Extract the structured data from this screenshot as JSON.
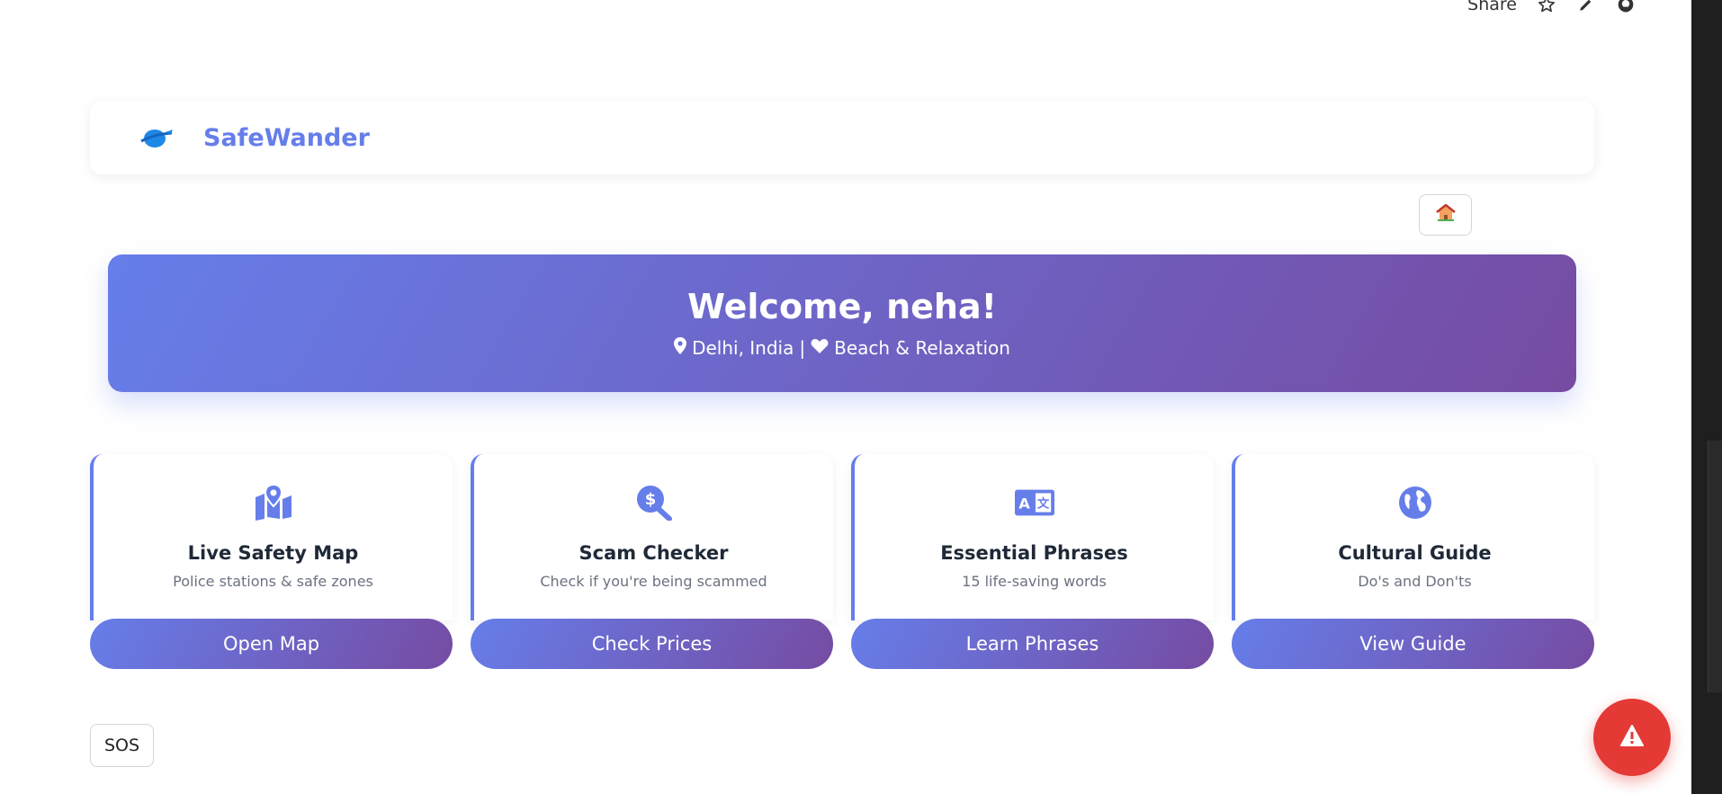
{
  "toolbar": {
    "share_label": "Share",
    "icons": [
      "star-icon",
      "pencil-icon",
      "github-icon"
    ]
  },
  "header": {
    "brand": "SafeWander",
    "logo_icon": "planet-icon",
    "home_icon": "house-icon"
  },
  "hero": {
    "greeting": "Welcome, neha!",
    "location": "Delhi, India",
    "separator": "|",
    "interest": "Beach & Relaxation",
    "location_icon": "map-marker-icon",
    "interest_icon": "heart-icon"
  },
  "cards": [
    {
      "title": "Live Safety Map",
      "desc": "Police stations & safe zones",
      "button": "Open Map",
      "icon": "map-icon"
    },
    {
      "title": "Scam Checker",
      "desc": "Check if you're being scammed",
      "button": "Check Prices",
      "icon": "search-dollar-icon"
    },
    {
      "title": "Essential Phrases",
      "desc": "15 life-saving words",
      "button": "Learn Phrases",
      "icon": "language-icon"
    },
    {
      "title": "Cultural Guide",
      "desc": "Do's and Don'ts",
      "button": "View Guide",
      "icon": "globe-icon"
    }
  ],
  "sos_label": "SOS",
  "fab_icon": "warning-icon",
  "colors": {
    "accent": "#667eea",
    "accent_end": "#764ba2",
    "danger": "#e53935"
  }
}
